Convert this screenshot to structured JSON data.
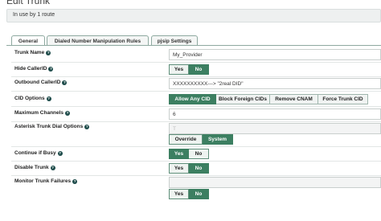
{
  "page": {
    "title": "Edit Trunk",
    "usage": "In use by 1 route"
  },
  "tabs": [
    {
      "label": "General",
      "active": true
    },
    {
      "label": "Dialed Number Manipulation Rules",
      "active": false
    },
    {
      "label": "pjsip Settings",
      "active": false
    }
  ],
  "fields": {
    "trunk_name": {
      "label": "Trunk Name",
      "value": "My_Provider"
    },
    "hide_callerid": {
      "label": "Hide CallerID",
      "yes": "Yes",
      "no": "No",
      "selected": "No"
    },
    "outbound_callerid": {
      "label": "Outbound CallerID",
      "value": "XXXXXXXXXX---> \"2real DID\""
    },
    "cid_options": {
      "label": "CID Options",
      "options": [
        "Allow Any CID",
        "Block Foreign CIDs",
        "Remove CNAM",
        "Force Trunk CID"
      ],
      "selected": "Allow Any CID"
    },
    "max_channels": {
      "label": "Maximum Channels",
      "value": "6"
    },
    "dial_options": {
      "label": "Asterisk Trunk Dial Options",
      "value": "T",
      "override": "Override",
      "system": "System",
      "selected": "System"
    },
    "continue_if_busy": {
      "label": "Continue if Busy",
      "yes": "Yes",
      "no": "No",
      "selected": "Yes"
    },
    "disable_trunk": {
      "label": "Disable Trunk",
      "yes": "Yes",
      "no": "No",
      "selected": "No"
    },
    "monitor_failures": {
      "label": "Monitor Trunk Failures",
      "yes": "Yes",
      "no": "No",
      "selected": "No"
    }
  },
  "icons": {
    "help": "help-icon"
  },
  "colors": {
    "accent": "#3c7f61",
    "tab_border": "#8ea9a0",
    "help": "#1d4b4a"
  }
}
